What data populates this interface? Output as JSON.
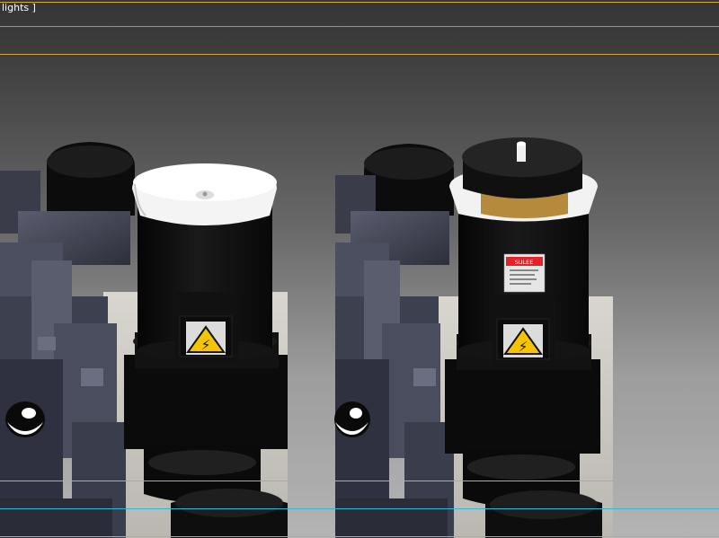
{
  "viewport": {
    "label": "lights ]",
    "background_top": "#353535",
    "background_bottom": "#b4b4b4"
  },
  "guides": {
    "safe_frame_color": "#e0a43c",
    "title_safe_color": "#35b6d2"
  },
  "warning_label": {
    "symbol": "⚡",
    "background": "#f5c400"
  },
  "nameplate": {
    "header": "SULEE",
    "header_color": "#e0242a"
  }
}
